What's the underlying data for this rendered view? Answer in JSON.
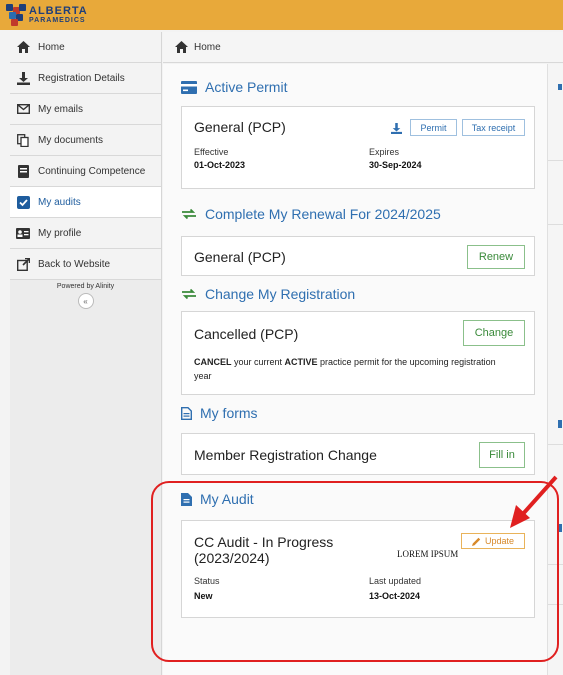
{
  "header": {
    "logo_line1": "ALBERTA",
    "logo_line2": "PARAMEDICS"
  },
  "sidebar": {
    "items": [
      {
        "label": "Home",
        "icon": "home-icon"
      },
      {
        "label": "Registration Details",
        "icon": "download-icon"
      },
      {
        "label": "My emails",
        "icon": "envelope-icon"
      },
      {
        "label": "My documents",
        "icon": "documents-icon"
      },
      {
        "label": "Continuing Competence",
        "icon": "book-icon"
      },
      {
        "label": "My audits",
        "icon": "checkbox-icon",
        "active": true
      },
      {
        "label": "My profile",
        "icon": "id-card-icon"
      },
      {
        "label": "Back to Website",
        "icon": "external-link-icon"
      }
    ],
    "powered_by": "Powered by Alinity",
    "collapse_label": "«"
  },
  "breadcrumb": {
    "label": "Home"
  },
  "active_permit": {
    "title": "Active Permit",
    "card_title": "General (PCP)",
    "permit_button": "Permit",
    "tax_button": "Tax receipt",
    "effective_label": "Effective",
    "effective_value": "01-Oct-2023",
    "expires_label": "Expires",
    "expires_value": "30-Sep-2024"
  },
  "renewal": {
    "title": "Complete My Renewal For 2024/2025",
    "card_title": "General (PCP)",
    "button": "Renew"
  },
  "change_registration": {
    "title": "Change My Registration",
    "card_title": "Cancelled (PCP)",
    "desc_bold1": "CANCEL",
    "desc_text1": " your current ",
    "desc_bold2": "ACTIVE",
    "desc_text2": " practice permit for the upcoming registration year",
    "button": "Change"
  },
  "forms": {
    "title": "My forms",
    "card_title": "Member Registration Change",
    "button": "Fill in"
  },
  "audit": {
    "title": "My Audit",
    "card_title_line1": "CC Audit - In Progress",
    "card_title_line2": "(2023/2024)",
    "overlay_text": "LOREM IPSUM",
    "button": "Update",
    "status_label": "Status",
    "status_value": "New",
    "updated_label": "Last updated",
    "updated_value": "13-Oct-2024"
  },
  "colors": {
    "topbar": "#e8a93a",
    "accent": "#2f6fb0",
    "green": "#3a8a3a",
    "annotation": "#e02020"
  }
}
